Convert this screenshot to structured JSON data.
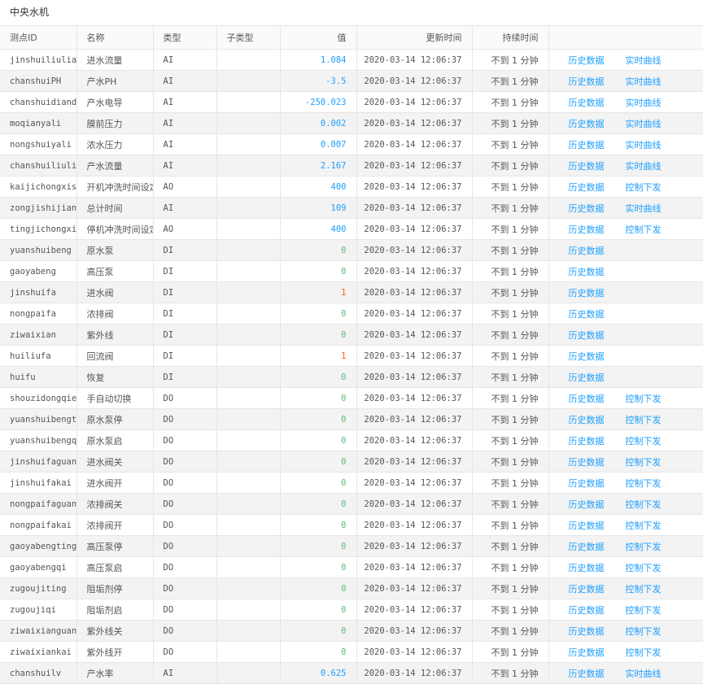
{
  "page_title": "中央水机",
  "columns": [
    "测点ID",
    "名称",
    "类型",
    "子类型",
    "值",
    "更新时间",
    "持续时间",
    ""
  ],
  "links": {
    "history": "历史数据",
    "realtime": "实时曲线",
    "control": "控制下发"
  },
  "colors": {
    "analog_value": "#1e9fff",
    "digital_on": "#ff5722",
    "digital_off": "#5fb878",
    "link": "#1e9fff"
  },
  "rows": [
    {
      "id": "jinshuiliuliang",
      "name": "进水流量",
      "type": "AI",
      "subtype": "",
      "value": "1.084",
      "time": "2020-03-14 12:06:37",
      "duration": "不到 1 分钟",
      "second_link": "实时曲线"
    },
    {
      "id": "chanshuiPH",
      "name": "产水PH",
      "type": "AI",
      "subtype": "",
      "value": "-3.5",
      "time": "2020-03-14 12:06:37",
      "duration": "不到 1 分钟",
      "second_link": "实时曲线"
    },
    {
      "id": "chanshuidiandao",
      "name": "产水电导",
      "type": "AI",
      "subtype": "",
      "value": "-250.023",
      "time": "2020-03-14 12:06:37",
      "duration": "不到 1 分钟",
      "second_link": "实时曲线"
    },
    {
      "id": "moqianyali",
      "name": "膜前压力",
      "type": "AI",
      "subtype": "",
      "value": "0.002",
      "time": "2020-03-14 12:06:37",
      "duration": "不到 1 分钟",
      "second_link": "实时曲线"
    },
    {
      "id": "nongshuiyali",
      "name": "浓水压力",
      "type": "AI",
      "subtype": "",
      "value": "0.007",
      "time": "2020-03-14 12:06:37",
      "duration": "不到 1 分钟",
      "second_link": "实时曲线"
    },
    {
      "id": "chanshuiliuliang",
      "name": "产水流量",
      "type": "AI",
      "subtype": "",
      "value": "2.167",
      "time": "2020-03-14 12:06:37",
      "duration": "不到 1 分钟",
      "second_link": "实时曲线"
    },
    {
      "id": "kaijichongxishijian",
      "name": "开机冲洗时间设定",
      "type": "AO",
      "subtype": "",
      "value": "400",
      "time": "2020-03-14 12:06:37",
      "duration": "不到 1 分钟",
      "second_link": "控制下发"
    },
    {
      "id": "zongjishijian",
      "name": "总计时间",
      "type": "AI",
      "subtype": "",
      "value": "109",
      "time": "2020-03-14 12:06:37",
      "duration": "不到 1 分钟",
      "second_link": "实时曲线"
    },
    {
      "id": "tingjichongxishijian",
      "name": "停机冲洗时间设定",
      "type": "AO",
      "subtype": "",
      "value": "400",
      "time": "2020-03-14 12:06:37",
      "duration": "不到 1 分钟",
      "second_link": "控制下发"
    },
    {
      "id": "yuanshuibeng",
      "name": "原水泵",
      "type": "DI",
      "subtype": "",
      "value": "0",
      "time": "2020-03-14 12:06:37",
      "duration": "不到 1 分钟",
      "second_link": ""
    },
    {
      "id": "gaoyabeng",
      "name": "高压泵",
      "type": "DI",
      "subtype": "",
      "value": "0",
      "time": "2020-03-14 12:06:37",
      "duration": "不到 1 分钟",
      "second_link": ""
    },
    {
      "id": "jinshuifa",
      "name": "进水阀",
      "type": "DI",
      "subtype": "",
      "value": "1",
      "time": "2020-03-14 12:06:37",
      "duration": "不到 1 分钟",
      "second_link": ""
    },
    {
      "id": "nongpaifa",
      "name": "浓排阀",
      "type": "DI",
      "subtype": "",
      "value": "0",
      "time": "2020-03-14 12:06:37",
      "duration": "不到 1 分钟",
      "second_link": ""
    },
    {
      "id": "ziwaixian",
      "name": "紫外线",
      "type": "DI",
      "subtype": "",
      "value": "0",
      "time": "2020-03-14 12:06:37",
      "duration": "不到 1 分钟",
      "second_link": ""
    },
    {
      "id": "huiliufa",
      "name": "回流阀",
      "type": "DI",
      "subtype": "",
      "value": "1",
      "time": "2020-03-14 12:06:37",
      "duration": "不到 1 分钟",
      "second_link": ""
    },
    {
      "id": "huifu",
      "name": "恢复",
      "type": "DI",
      "subtype": "",
      "value": "0",
      "time": "2020-03-14 12:06:37",
      "duration": "不到 1 分钟",
      "second_link": ""
    },
    {
      "id": "shouzidongqiehuan",
      "name": "手自动切换",
      "type": "DO",
      "subtype": "",
      "value": "0",
      "time": "2020-03-14 12:06:37",
      "duration": "不到 1 分钟",
      "second_link": "控制下发"
    },
    {
      "id": "yuanshuibengting",
      "name": "原水泵停",
      "type": "DO",
      "subtype": "",
      "value": "0",
      "time": "2020-03-14 12:06:37",
      "duration": "不到 1 分钟",
      "second_link": "控制下发"
    },
    {
      "id": "yuanshuibengqi",
      "name": "原水泵启",
      "type": "DO",
      "subtype": "",
      "value": "0",
      "time": "2020-03-14 12:06:37",
      "duration": "不到 1 分钟",
      "second_link": "控制下发"
    },
    {
      "id": "jinshuifaguan",
      "name": "进水阀关",
      "type": "DO",
      "subtype": "",
      "value": "0",
      "time": "2020-03-14 12:06:37",
      "duration": "不到 1 分钟",
      "second_link": "控制下发"
    },
    {
      "id": "jinshuifakai",
      "name": "进水阀开",
      "type": "DO",
      "subtype": "",
      "value": "0",
      "time": "2020-03-14 12:06:37",
      "duration": "不到 1 分钟",
      "second_link": "控制下发"
    },
    {
      "id": "nongpaifaguan",
      "name": "浓排阀关",
      "type": "DO",
      "subtype": "",
      "value": "0",
      "time": "2020-03-14 12:06:37",
      "duration": "不到 1 分钟",
      "second_link": "控制下发"
    },
    {
      "id": "nongpaifakai",
      "name": "浓排阀开",
      "type": "DO",
      "subtype": "",
      "value": "0",
      "time": "2020-03-14 12:06:37",
      "duration": "不到 1 分钟",
      "second_link": "控制下发"
    },
    {
      "id": "gaoyabengting",
      "name": "高压泵停",
      "type": "DO",
      "subtype": "",
      "value": "0",
      "time": "2020-03-14 12:06:37",
      "duration": "不到 1 分钟",
      "second_link": "控制下发"
    },
    {
      "id": "gaoyabengqi",
      "name": "高压泵启",
      "type": "DO",
      "subtype": "",
      "value": "0",
      "time": "2020-03-14 12:06:37",
      "duration": "不到 1 分钟",
      "second_link": "控制下发"
    },
    {
      "id": "zugoujiting",
      "name": "阻垢剂停",
      "type": "DO",
      "subtype": "",
      "value": "0",
      "time": "2020-03-14 12:06:37",
      "duration": "不到 1 分钟",
      "second_link": "控制下发"
    },
    {
      "id": "zugoujiqi",
      "name": "阻垢剂启",
      "type": "DO",
      "subtype": "",
      "value": "0",
      "time": "2020-03-14 12:06:37",
      "duration": "不到 1 分钟",
      "second_link": "控制下发"
    },
    {
      "id": "ziwaixianguan",
      "name": "紫外线关",
      "type": "DO",
      "subtype": "",
      "value": "0",
      "time": "2020-03-14 12:06:37",
      "duration": "不到 1 分钟",
      "second_link": "控制下发"
    },
    {
      "id": "ziwaixiankai",
      "name": "紫外线开",
      "type": "DO",
      "subtype": "",
      "value": "0",
      "time": "2020-03-14 12:06:37",
      "duration": "不到 1 分钟",
      "second_link": "控制下发"
    },
    {
      "id": "chanshuilv",
      "name": "产水率",
      "type": "AI",
      "subtype": "",
      "value": "0.625",
      "time": "2020-03-14 12:06:37",
      "duration": "不到 1 分钟",
      "second_link": "实时曲线"
    }
  ]
}
